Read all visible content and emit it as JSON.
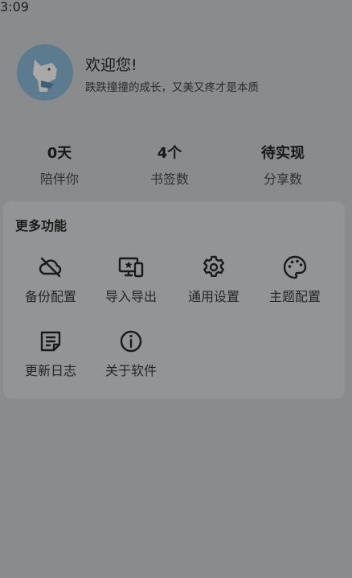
{
  "status_bar": {
    "time": "3:09"
  },
  "profile": {
    "greeting": "欢迎您!",
    "subtitle": "跌跌撞撞的成长，又美又疼才是本质"
  },
  "stats": [
    {
      "value": "0天",
      "label": "陪伴你"
    },
    {
      "value": "4个",
      "label": "书签数"
    },
    {
      "value": "待实现",
      "label": "分享数"
    }
  ],
  "more_features": {
    "title": "更多功能",
    "items": [
      {
        "label": "备份配置",
        "icon": "cloud-off-icon"
      },
      {
        "label": "导入导出",
        "icon": "import-export-icon"
      },
      {
        "label": "通用设置",
        "icon": "gear-icon"
      },
      {
        "label": "主题配置",
        "icon": "palette-icon"
      },
      {
        "label": "更新日志",
        "icon": "note-icon"
      },
      {
        "label": "关于软件",
        "icon": "info-icon"
      }
    ]
  }
}
